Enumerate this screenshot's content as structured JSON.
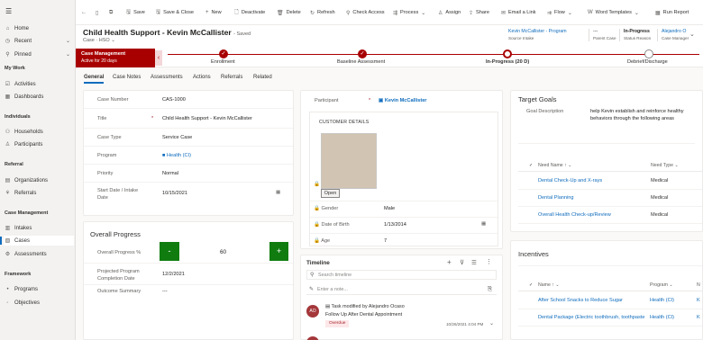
{
  "sidebar": {
    "items_top": [
      {
        "label": "Home",
        "icon": "home-icon"
      },
      {
        "label": "Recent",
        "icon": "clock-icon"
      },
      {
        "label": "Pinned",
        "icon": "pin-icon"
      }
    ],
    "my_work": {
      "header": "My Work",
      "items": [
        "Activities",
        "Dashboards"
      ]
    },
    "individuals": {
      "header": "Individuals",
      "items": [
        "Households",
        "Participants"
      ]
    },
    "referral": {
      "header": "Referral",
      "items": [
        "Organizations",
        "Referrals"
      ]
    },
    "case_management": {
      "header": "Case Management",
      "items": [
        "Intakes",
        "Cases",
        "Assessments"
      ]
    },
    "framework": {
      "header": "Framework",
      "items": [
        "Programs",
        "Objectives"
      ]
    }
  },
  "commandbar": {
    "save": "Save",
    "save_close": "Save & Close",
    "new": "New",
    "deactivate": "Deactivate",
    "delete": "Delete",
    "refresh": "Refresh",
    "check_access": "Check Access",
    "process": "Process",
    "assign": "Assign",
    "share": "Share",
    "email_link": "Email a Link",
    "flow": "Flow",
    "word_templates": "Word Templates",
    "run_report": "Run Report"
  },
  "header": {
    "title": "Child Health Support - Kevin McCallister",
    "saved": "- Saved",
    "entity": "Case",
    "form": "HSO",
    "fields": [
      {
        "value": "Kevin McCallister - Program",
        "label": "Source Intake"
      },
      {
        "value": "---",
        "label": "Parent Case"
      },
      {
        "value": "In-Progress",
        "label": "Status Reason"
      },
      {
        "value": "Alejandro O",
        "label": "Case Manager"
      }
    ]
  },
  "bpf": {
    "active_name": "Case Management",
    "active_for": "Active for 20 days",
    "stages": [
      "Enrollment",
      "Baseline Assessment",
      "In-Progress (20 D)",
      "Debrief/Discharge"
    ]
  },
  "tabs": [
    "General",
    "Case Notes",
    "Assessments",
    "Actions",
    "Referrals",
    "Related"
  ],
  "general": {
    "case_number_label": "Case Number",
    "case_number": "CAS-1000",
    "title_label": "Title",
    "title": "Child Health Support - Kevin McCallister",
    "case_type_label": "Case Type",
    "case_type": "Service Case",
    "program_label": "Program",
    "program": "Health (CI)",
    "priority_label": "Priority",
    "priority": "Normal",
    "start_label_1": "Start Date / Intake",
    "start_label_2": "Date",
    "start_date": "10/15/2021"
  },
  "progress": {
    "title": "Overall Progress",
    "overall_label": "Overall Progress %",
    "minus": "-",
    "plus": "+",
    "value": "60",
    "projected_label_1": "Projected Program",
    "projected_label_2": "Completion Date",
    "projected": "12/2/2021",
    "outcome_label": "Outcome Summary",
    "outcome": "---"
  },
  "participant": {
    "label": "Participant",
    "value": "Kevin McCallister",
    "customer_details": "CUSTOMER DETAILS",
    "open": "Open",
    "gender_label": "Gender",
    "gender": "Male",
    "dob_label": "Date of Birth",
    "dob": "1/13/2014",
    "age_label": "Age",
    "age": "7"
  },
  "timeline": {
    "title": "Timeline",
    "search_placeholder": "Search timeline",
    "note_placeholder": "Enter a note...",
    "avatar_initials": "AO",
    "entry_title": "Task modified by Alejandro Ocaso",
    "entry_subtitle": "Follow Up After Dental Appointment",
    "entry_badge": "Overdue",
    "entry_time": "10/26/2021 4:04 PM"
  },
  "goals": {
    "title": "Target Goals",
    "desc_label": "Goal Description",
    "desc_line1": "help Kevin establish and reinforce healthy",
    "desc_line2": "behaviors through the following areas",
    "col_name": "Need Name ↑",
    "col_type": "Need Type",
    "rows": [
      {
        "name": "Dental Check-Up and X-rays",
        "type": "Medical"
      },
      {
        "name": "Dental Planning",
        "type": "Medical"
      },
      {
        "name": "Overall Health Check-up/Review",
        "type": "Medical"
      }
    ]
  },
  "incentives": {
    "title": "Incentives",
    "col_name": "Name ↑",
    "col_program": "Program",
    "col_k": "N",
    "rows": [
      {
        "name": "After School Snacks to Reduce Sugar",
        "program": "Health (CI)",
        "k": "K"
      },
      {
        "name": "Dental Package (Electric toothbrush, toothpaste",
        "program": "Health (CI)",
        "k": "K"
      }
    ]
  },
  "colors": {
    "accent": "#0f6cbd",
    "stage": "#a80000",
    "plus_button": "#107c10"
  }
}
